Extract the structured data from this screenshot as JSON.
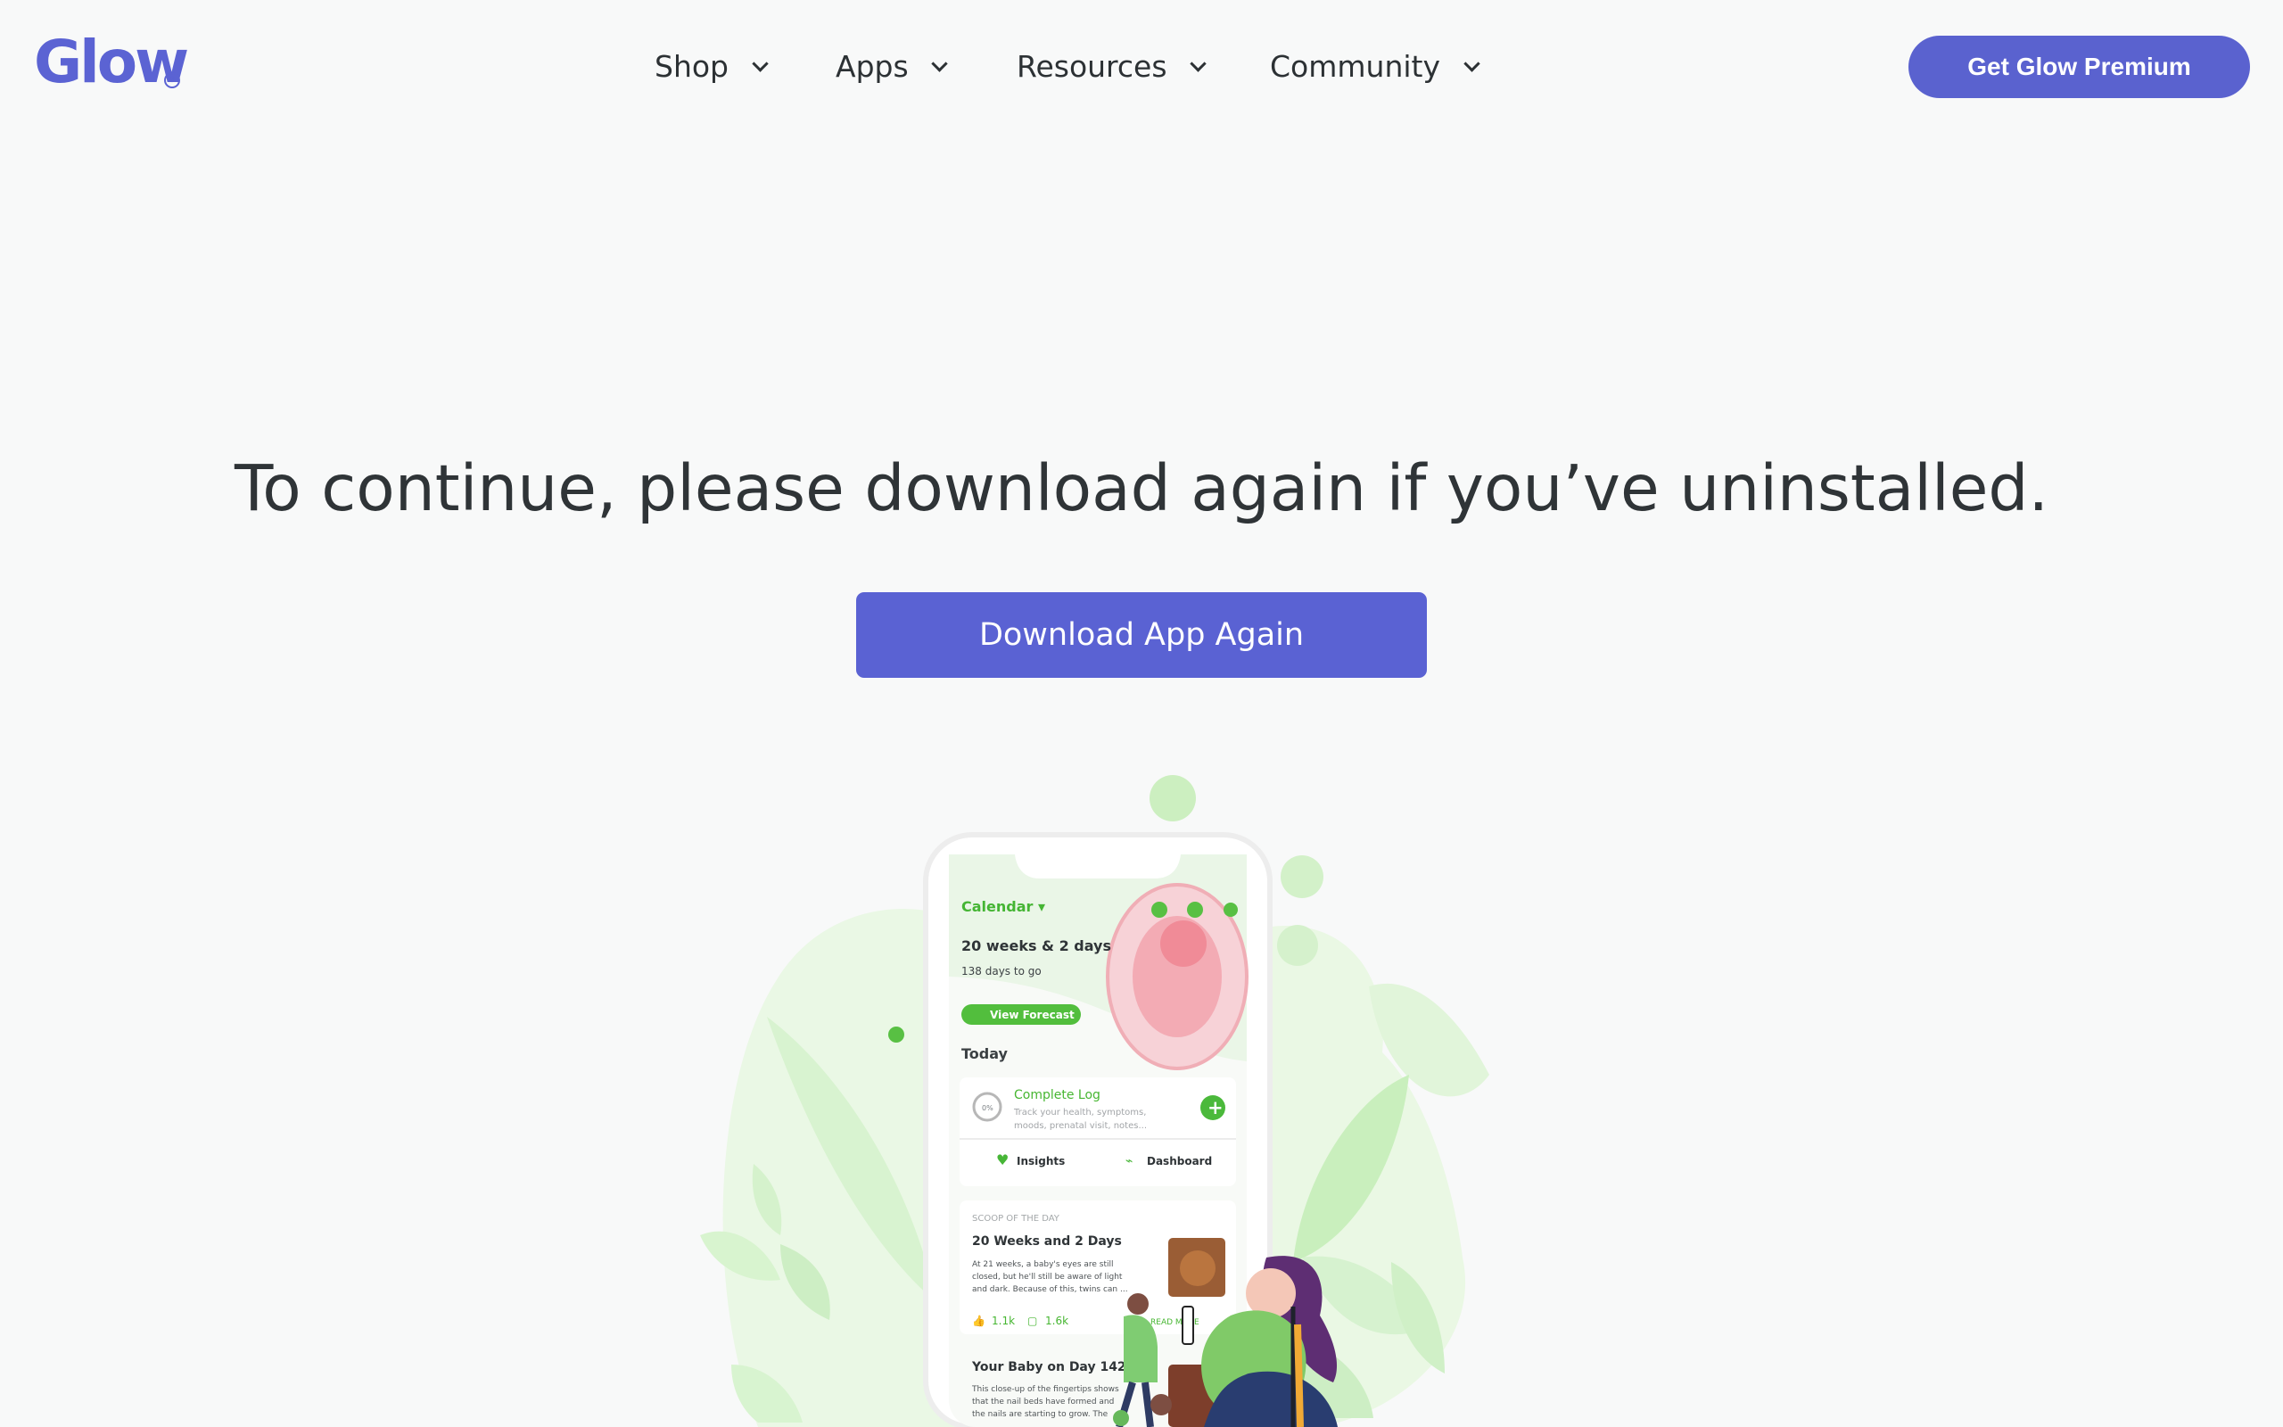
{
  "brand": {
    "name": "Glow",
    "accent": "#5b63d3",
    "registered_mark": "®"
  },
  "nav": {
    "items": [
      {
        "label": "Shop"
      },
      {
        "label": "Apps"
      },
      {
        "label": "Resources"
      },
      {
        "label": "Community"
      }
    ],
    "cta_label": "Get Glow Premium"
  },
  "main": {
    "headline": "To continue, please download again if you’ve uninstalled.",
    "download_label": "Download App Again"
  },
  "phone": {
    "calendar_label": "Calendar ▾",
    "pregnancy_week": "20 weeks & 2 days",
    "days_to_go": "138 days to go",
    "forecast_button": "View Forecast",
    "today_label": "Today",
    "complete_log_title": "Complete Log",
    "complete_log_desc_1": "Track your health, symptoms,",
    "complete_log_desc_2": "moods, prenatal visit, notes...",
    "progress_label": "0%",
    "insights_label": "Insights",
    "dashboard_label": "Dashboard",
    "scoop_label": "SCOOP OF THE DAY",
    "scoop_title": "20 Weeks and 2 Days",
    "scoop_desc_1": "At 21 weeks, a baby's eyes are still",
    "scoop_desc_2": "closed, but he'll still be aware of light",
    "scoop_desc_3": "and dark. Because of this, twins can ...",
    "likes": "1.1k",
    "comments": "1.6k",
    "read_more": "READ MORE",
    "baby_title": "Your Baby on Day 142",
    "baby_desc_1": "This close-up of the fingertips shows",
    "baby_desc_2": "that the nail beds have formed and",
    "baby_desc_3": "the nails are starting to grow. The"
  }
}
